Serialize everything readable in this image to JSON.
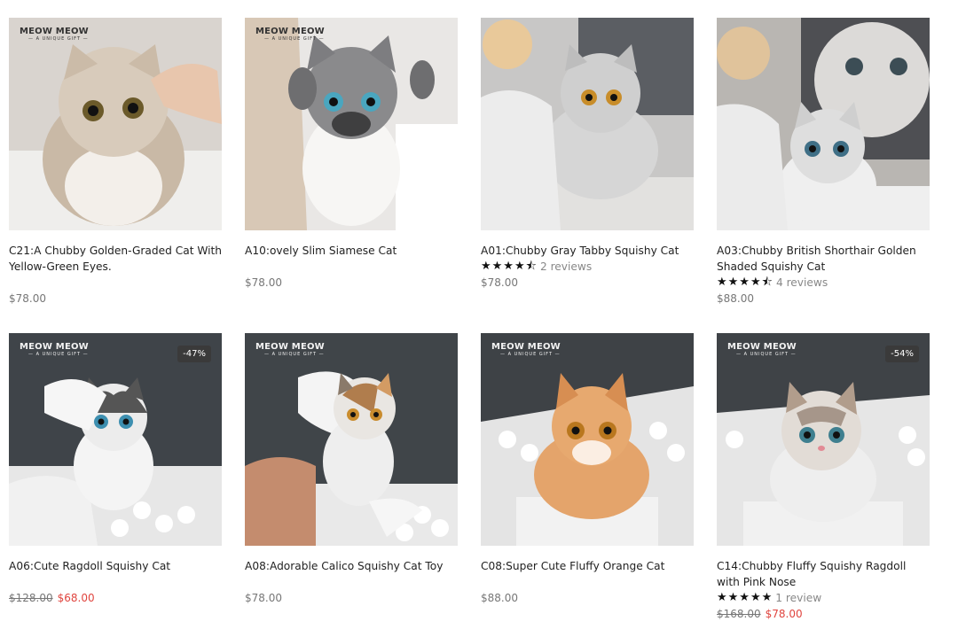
{
  "products": [
    {
      "brand": "MEOW MEOW",
      "badge": "",
      "title": "C21:A Chubby Golden-Graded Cat With Yellow-Green Eyes.",
      "stars": "",
      "reviews": "",
      "price": "$78.00",
      "old_price": "",
      "sale_price": ""
    },
    {
      "brand": "MEOW MEOW",
      "badge": "",
      "title": "A10:ovely Slim Siamese Cat",
      "stars": "",
      "reviews": "",
      "price": "$78.00",
      "old_price": "",
      "sale_price": ""
    },
    {
      "brand": "",
      "badge": "",
      "title": "A01:Chubby Gray Tabby Squishy Cat",
      "stars": "★★★★⯪",
      "rating": 4.5,
      "reviews": "2 reviews",
      "price": "$78.00",
      "old_price": "",
      "sale_price": ""
    },
    {
      "brand": "",
      "badge": "",
      "title": "A03:Chubby British Shorthair Golden Shaded Squishy Cat",
      "stars": "★★★★⯪",
      "rating": 4.5,
      "reviews": "4 reviews",
      "price": "$88.00",
      "old_price": "",
      "sale_price": ""
    },
    {
      "brand": "MEOW MEOW",
      "badge": "-47%",
      "title": "A06:Cute Ragdoll Squishy Cat",
      "stars": "",
      "reviews": "",
      "price": "",
      "old_price": "$128.00",
      "sale_price": "$68.00"
    },
    {
      "brand": "MEOW MEOW",
      "badge": "",
      "title": "A08:Adorable Calico Squishy Cat Toy",
      "stars": "",
      "reviews": "",
      "price": "$78.00",
      "old_price": "",
      "sale_price": ""
    },
    {
      "brand": "MEOW MEOW",
      "badge": "",
      "title": "C08:Super Cute Fluffy Orange Cat",
      "stars": "",
      "reviews": "",
      "price": "$88.00",
      "old_price": "",
      "sale_price": ""
    },
    {
      "brand": "MEOW MEOW",
      "badge": "-54%",
      "title": "C14:Chubby Fluffy Squishy Ragdoll with Pink Nose",
      "stars": "★★★★★",
      "rating": 5,
      "reviews": "1 review",
      "price": "",
      "old_price": "$168.00",
      "sale_price": "$78.00"
    }
  ],
  "colors": {
    "sale": "#e0453f",
    "badge_bg": "#3a3a3a",
    "reviews": "#888888"
  }
}
